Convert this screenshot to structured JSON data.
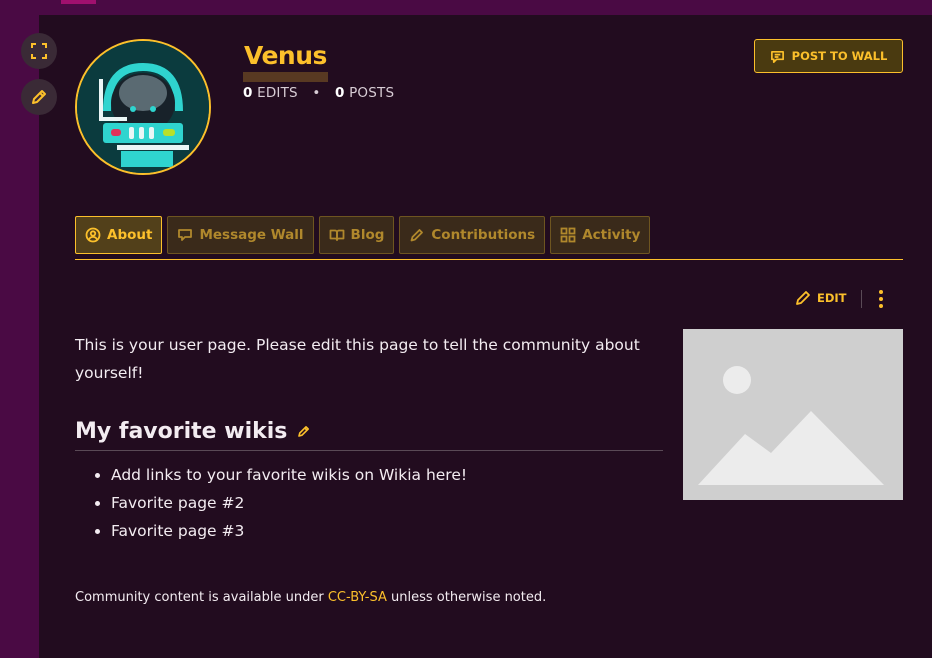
{
  "profile": {
    "name": "Venus",
    "edits_count": "0",
    "edits_label": "EDITS",
    "posts_count": "0",
    "posts_label": "POSTS",
    "post_wall_label": "POST TO WALL"
  },
  "tabs": [
    {
      "label": "About",
      "icon": "user-circle-icon",
      "active": true
    },
    {
      "label": "Message Wall",
      "icon": "speech-bubble-icon",
      "active": false
    },
    {
      "label": "Blog",
      "icon": "open-book-icon",
      "active": false
    },
    {
      "label": "Contributions",
      "icon": "pencil-icon",
      "active": false
    },
    {
      "label": "Activity",
      "icon": "grid-icon",
      "active": false
    }
  ],
  "page": {
    "edit_label": "EDIT",
    "intro": "This is your user page. Please edit this page to tell the community about yourself!",
    "section_title": "My favorite wikis",
    "favorites": [
      "Add links to your favorite wikis on Wikia here!",
      "Favorite page #2",
      "Favorite page #3"
    ]
  },
  "footer": {
    "license_prefix": "Community content is available under ",
    "license_link": "CC-BY-SA",
    "license_suffix": " unless otherwise noted."
  },
  "colors": {
    "accent": "#fcc02b",
    "background": "#220c1f",
    "frame": "#4a0a44"
  }
}
